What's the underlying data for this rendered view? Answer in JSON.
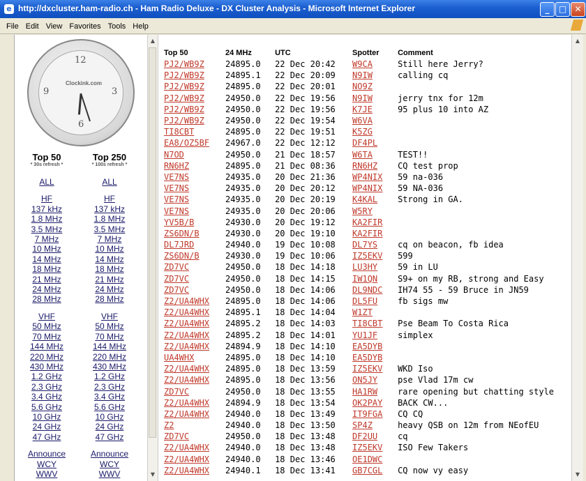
{
  "window": {
    "title": "http://dxcluster.ham-radio.ch - Ham Radio Deluxe - DX Cluster Analysis - Microsoft Internet Explorer"
  },
  "menu": [
    "File",
    "Edit",
    "View",
    "Favorites",
    "Tools",
    "Help"
  ],
  "clock": {
    "brand": "Clockink.com"
  },
  "nav": {
    "col1": {
      "heading": "Top 50",
      "sub": "* 30s refresh *",
      "all": "ALL",
      "hf_head": "HF",
      "hf": [
        "137 kHz",
        "1.8 MHz",
        "3.5 MHz",
        "7 MHz",
        "10 MHz",
        "14 MHz",
        "18 MHz",
        "21 MHz",
        "24 MHz",
        "28 MHz"
      ],
      "vhf_head": "VHF",
      "vhf": [
        "50 MHz",
        "70 MHz",
        "144 MHz",
        "220 MHz",
        "430 MHz",
        "1.2 GHz",
        "2.3 GHz",
        "3.4 GHz",
        "5.6 GHz",
        "10 GHz",
        "24 GHz",
        "47 GHz"
      ],
      "announce": "Announce",
      "extra": [
        "WCY",
        "WWV"
      ]
    },
    "col2": {
      "heading": "Top 250",
      "sub": "* 100s refresh *",
      "all": "ALL",
      "hf_head": "HF",
      "hf": [
        "137 kHz",
        "1.8 MHz",
        "3.5 MHz",
        "7 MHz",
        "10 MHz",
        "14 MHz",
        "18 MHz",
        "21 MHz",
        "24 MHz",
        "28 MHz"
      ],
      "vhf_head": "VHF",
      "vhf": [
        "50 MHz",
        "70 MHz",
        "144 MHz",
        "220 MHz",
        "430 MHz",
        "1.2 GHz",
        "2.3 GHz",
        "3.4 GHz",
        "5.6 GHz",
        "10 GHz",
        "24 GHz",
        "47 GHz"
      ],
      "announce": "Announce",
      "extra": [
        "WCY",
        "WWV"
      ]
    }
  },
  "table": {
    "headers": [
      "Top 50",
      "24 MHz",
      "UTC",
      "Spotter",
      "Comment"
    ],
    "rows": [
      [
        "PJ2/WB9Z",
        "24895.0",
        "22 Dec 20:42",
        "W9CA",
        "Still here Jerry?"
      ],
      [
        "PJ2/WB9Z",
        "24895.1",
        "22 Dec 20:09",
        "N9IW",
        "calling cq"
      ],
      [
        "PJ2/WB9Z",
        "24895.0",
        "22 Dec 20:01",
        "NO9Z",
        ""
      ],
      [
        "PJ2/WB9Z",
        "24950.0",
        "22 Dec 19:56",
        "N9IW",
        "jerry tnx for 12m"
      ],
      [
        "PJ2/WB9Z",
        "24950.0",
        "22 Dec 19:56",
        "K7JE",
        "95 plus 10 into AZ"
      ],
      [
        "PJ2/WB9Z",
        "24950.0",
        "22 Dec 19:54",
        "W6VA",
        ""
      ],
      [
        "TI8CBT",
        "24895.0",
        "22 Dec 19:51",
        "K5ZG",
        ""
      ],
      [
        "EA8/OZ5BF",
        "24967.0",
        "22 Dec 12:12",
        "DF4PL",
        ""
      ],
      [
        "N7OD",
        "24950.0",
        "21 Dec 18:57",
        "W6TA",
        "TEST!!"
      ],
      [
        "RN6HZ",
        "24895.0",
        "21 Dec 08:36",
        "RN6HZ",
        "CQ test prop"
      ],
      [
        "VE7NS",
        "24935.0",
        "20 Dec 21:36",
        "WP4NIX",
        "59 na-036"
      ],
      [
        "VE7NS",
        "24935.0",
        "20 Dec 20:12",
        "WP4NIX",
        "59 NA-036"
      ],
      [
        "VE7NS",
        "24935.0",
        "20 Dec 20:19",
        "K4KAL",
        "Strong in GA."
      ],
      [
        "VE7NS",
        "24935.0",
        "20 Dec 20:06",
        "W5RY",
        ""
      ],
      [
        "YV5B/B",
        "24930.0",
        "20 Dec 19:12",
        "KA2FIR",
        ""
      ],
      [
        "ZS6DN/B",
        "24930.0",
        "20 Dec 19:10",
        "KA2FIR",
        ""
      ],
      [
        "DL7JRD",
        "24940.0",
        "19 Dec 10:08",
        "DL7YS",
        "cq on beacon, fb idea"
      ],
      [
        "ZS6DN/B",
        "24930.0",
        "19 Dec 10:06",
        "IZ5EKV",
        "599"
      ],
      [
        "ZD7VC",
        "24950.0",
        "18 Dec 14:18",
        "LU3HY",
        "59 in LU"
      ],
      [
        "ZD7VC",
        "24950.0",
        "18 Dec 14:15",
        "IW1QN",
        "S9+ on my RB, strong and Easy"
      ],
      [
        "ZD7VC",
        "24950.0",
        "18 Dec 14:06",
        "DL9NDC",
        "IH74 55 - 59 Bruce in JN59"
      ],
      [
        "Z2/UA4WHX",
        "24895.0",
        "18 Dec 14:06",
        "DL5FU",
        "fb sigs mw"
      ],
      [
        "Z2/UA4WHX",
        "24895.1",
        "18 Dec 14:04",
        "W1ZT",
        ""
      ],
      [
        "Z2/UA4WHX",
        "24895.2",
        "18 Dec 14:03",
        "TI8CBT",
        "Pse Beam To Costa Rica"
      ],
      [
        "Z2/UA4WHX",
        "24895.2",
        "18 Dec 14:01",
        "YU1JF",
        "simplex"
      ],
      [
        "Z2/UA4WHX",
        "24894.9",
        "18 Dec 14:10",
        "EA5DYB",
        ""
      ],
      [
        "UA4WHX",
        "24895.0",
        "18 Dec 14:10",
        "EA5DYB",
        ""
      ],
      [
        "Z2/UA4WHX",
        "24895.0",
        "18 Dec 13:59",
        "IZ5EKV",
        "WKD Iso"
      ],
      [
        "Z2/UA4WHX",
        "24895.0",
        "18 Dec 13:56",
        "ON5JY",
        "pse Vlad 17m cw"
      ],
      [
        "ZD7VC",
        "24950.0",
        "18 Dec 13:55",
        "HA1RW",
        "rare opening but chatting style"
      ],
      [
        "Z2/UA4WHX",
        "24894.9",
        "18 Dec 13:54",
        "OK2PAY",
        "BACK CW..."
      ],
      [
        "Z2/UA4WHX",
        "24940.0",
        "18 Dec 13:49",
        "IT9FGA",
        "CQ CQ"
      ],
      [
        "Z2",
        "24940.0",
        "18 Dec 13:50",
        "SP4Z",
        "heavy QSB on 12m from NEofEU"
      ],
      [
        "ZD7VC",
        "24950.0",
        "18 Dec 13:48",
        "DF2UU",
        "cq"
      ],
      [
        "Z2/UA4WHX",
        "24940.0",
        "18 Dec 13:48",
        "IZ5EKV",
        "ISO Few Takers"
      ],
      [
        "Z2/UA4WHX",
        "24940.0",
        "18 Dec 13:46",
        "OE1DWC",
        ""
      ],
      [
        "Z2/UA4WHX",
        "24940.1",
        "18 Dec 13:41",
        "GB7CGL",
        "CQ now vy easy"
      ]
    ]
  }
}
